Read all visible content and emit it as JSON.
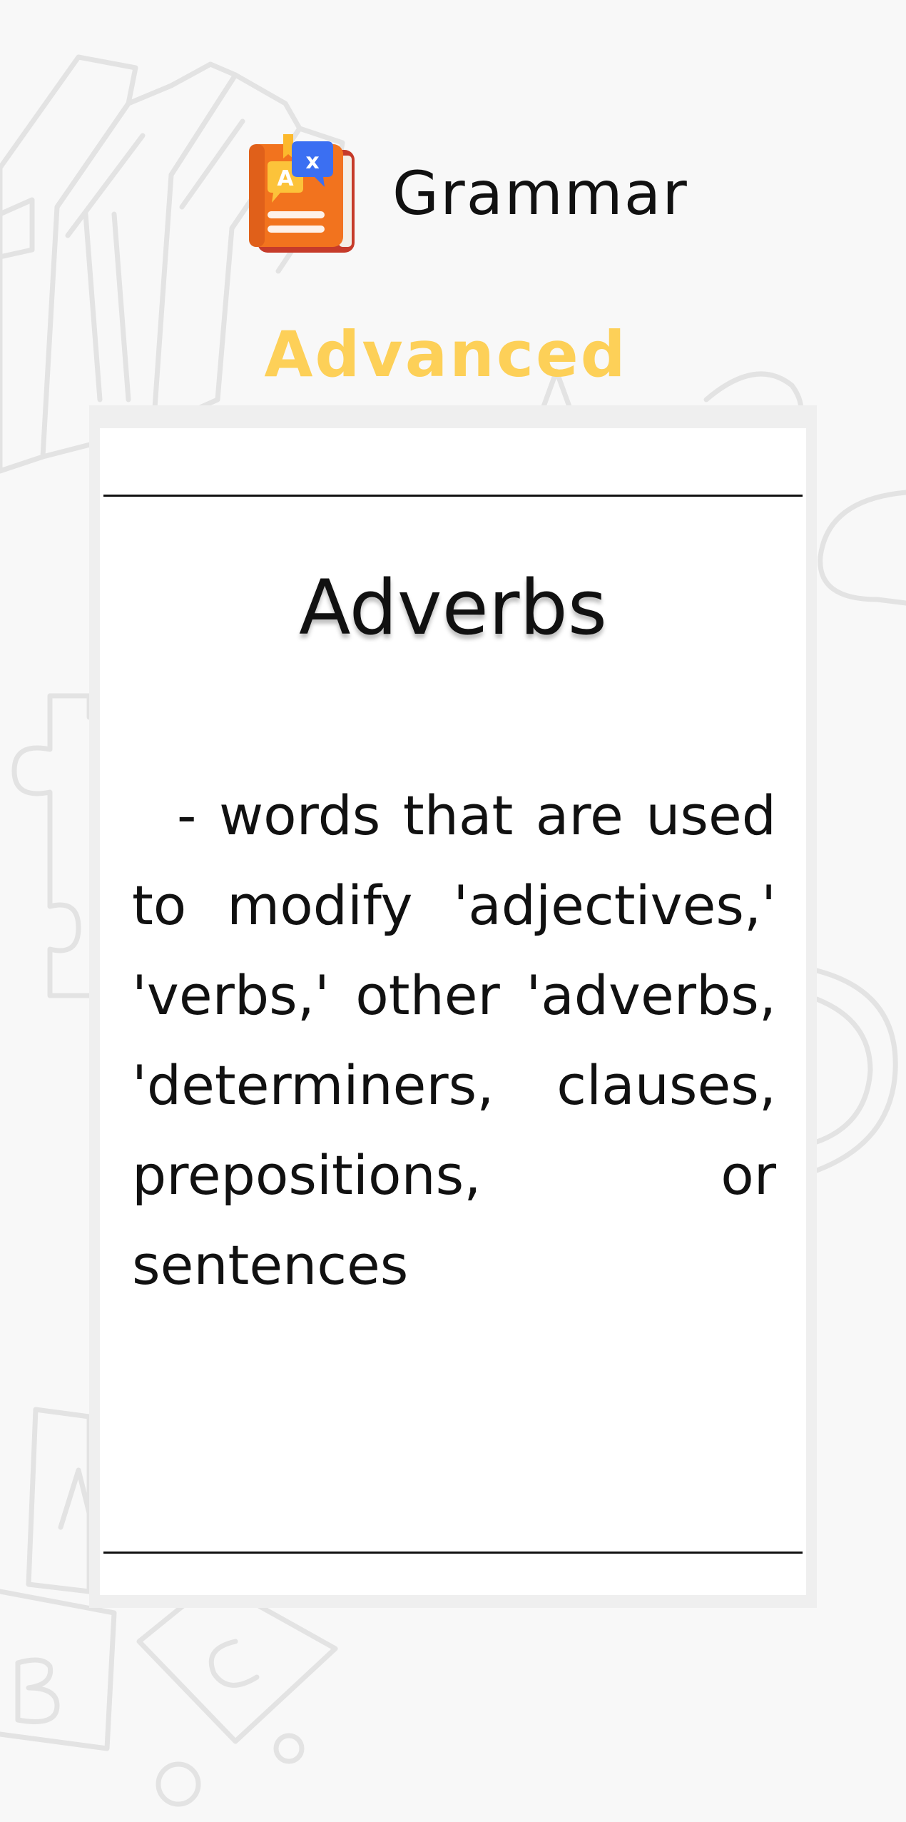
{
  "app": {
    "title": "Grammar",
    "icon": "grammar-book-translate-icon"
  },
  "level": {
    "label": "Advanced",
    "color": "#fdd058"
  },
  "card": {
    "title": "Adverbs",
    "definition": "  - words that are used to modify 'adjectives,' 'verbs,' other 'adverbs, 'determiners, clauses, prepositions, or sentences"
  },
  "background": {
    "doodles": [
      "books-doodle",
      "letter-a-doodle",
      "puzzle-piece-doodle",
      "mug-doodle",
      "letter-blocks-doodle"
    ]
  }
}
